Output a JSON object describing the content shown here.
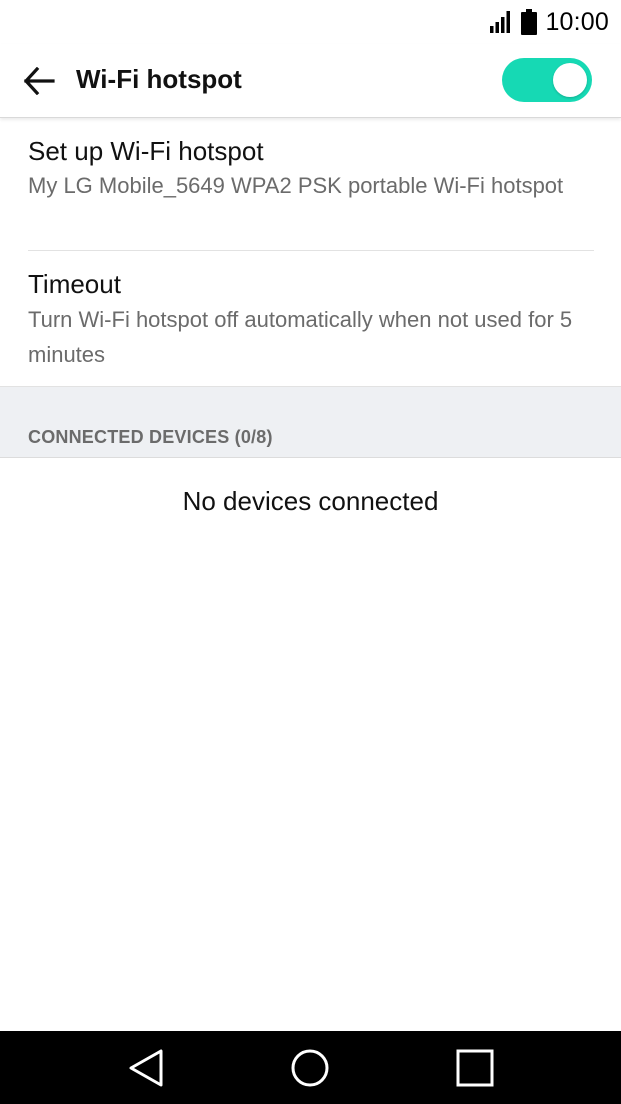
{
  "status_bar": {
    "time": "10:00",
    "icons": [
      "signal-icon",
      "battery-icon"
    ]
  },
  "app_bar": {
    "title": "Wi-Fi hotspot",
    "back_icon": "arrow-left-icon",
    "toggle_on": true,
    "accent_color": "#16d9b4"
  },
  "settings": [
    {
      "title": "Set up Wi-Fi hotspot",
      "subtitle": "My LG Mobile_5649 WPA2 PSK portable Wi-Fi hotspot"
    },
    {
      "title": "Timeout",
      "subtitle": "Turn Wi-Fi hotspot off automatically when not used for 5 minutes"
    }
  ],
  "connected_devices": {
    "header": "CONNECTED DEVICES (0/8)",
    "empty_message": "No devices connected"
  },
  "nav_bar": {
    "icons": [
      "back-triangle-icon",
      "home-circle-icon",
      "recents-square-icon"
    ]
  }
}
